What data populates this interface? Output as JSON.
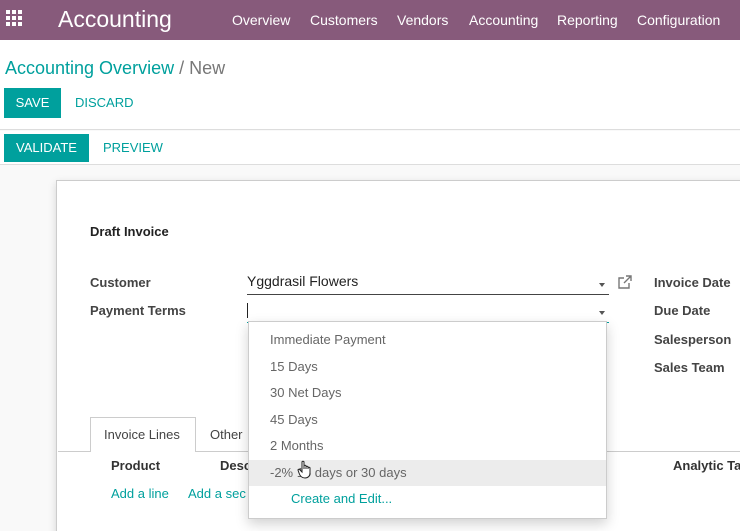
{
  "navbar": {
    "brand": "Accounting",
    "menu": [
      "Overview",
      "Customers",
      "Vendors",
      "Accounting",
      "Reporting",
      "Configuration"
    ]
  },
  "breadcrumb": {
    "parent": "Accounting Overview",
    "separator": "/",
    "current": "New"
  },
  "actions": {
    "save": "SAVE",
    "discard": "DISCARD",
    "validate": "VALIDATE",
    "preview": "PREVIEW"
  },
  "form": {
    "title": "Draft Invoice",
    "customer_label": "Customer",
    "customer_value": "Yggdrasil Flowers",
    "payment_terms_label": "Payment Terms",
    "payment_terms_value": "",
    "right_labels": [
      "Invoice Date",
      "Due Date",
      "Salesperson",
      "Sales Team"
    ]
  },
  "tabs": [
    "Invoice Lines",
    "Other"
  ],
  "lines": {
    "columns": [
      "Product",
      "Desc",
      "Analytic Ta"
    ],
    "add_line": "Add a line",
    "add_section": "Add a sec"
  },
  "payment_terms_dropdown": {
    "options": [
      "Immediate Payment",
      "15 Days",
      "30 Net Days",
      "45 Days",
      "2 Months",
      "-2% 15 days or 30 days"
    ],
    "create_and_edit": "Create and Edit..."
  },
  "colors": {
    "brand": "#875a7b",
    "accent": "#00a09d"
  },
  "icons": [
    "apps-grid-icon",
    "external-link-icon",
    "hand-cursor-icon",
    "caret-down-icon"
  ]
}
